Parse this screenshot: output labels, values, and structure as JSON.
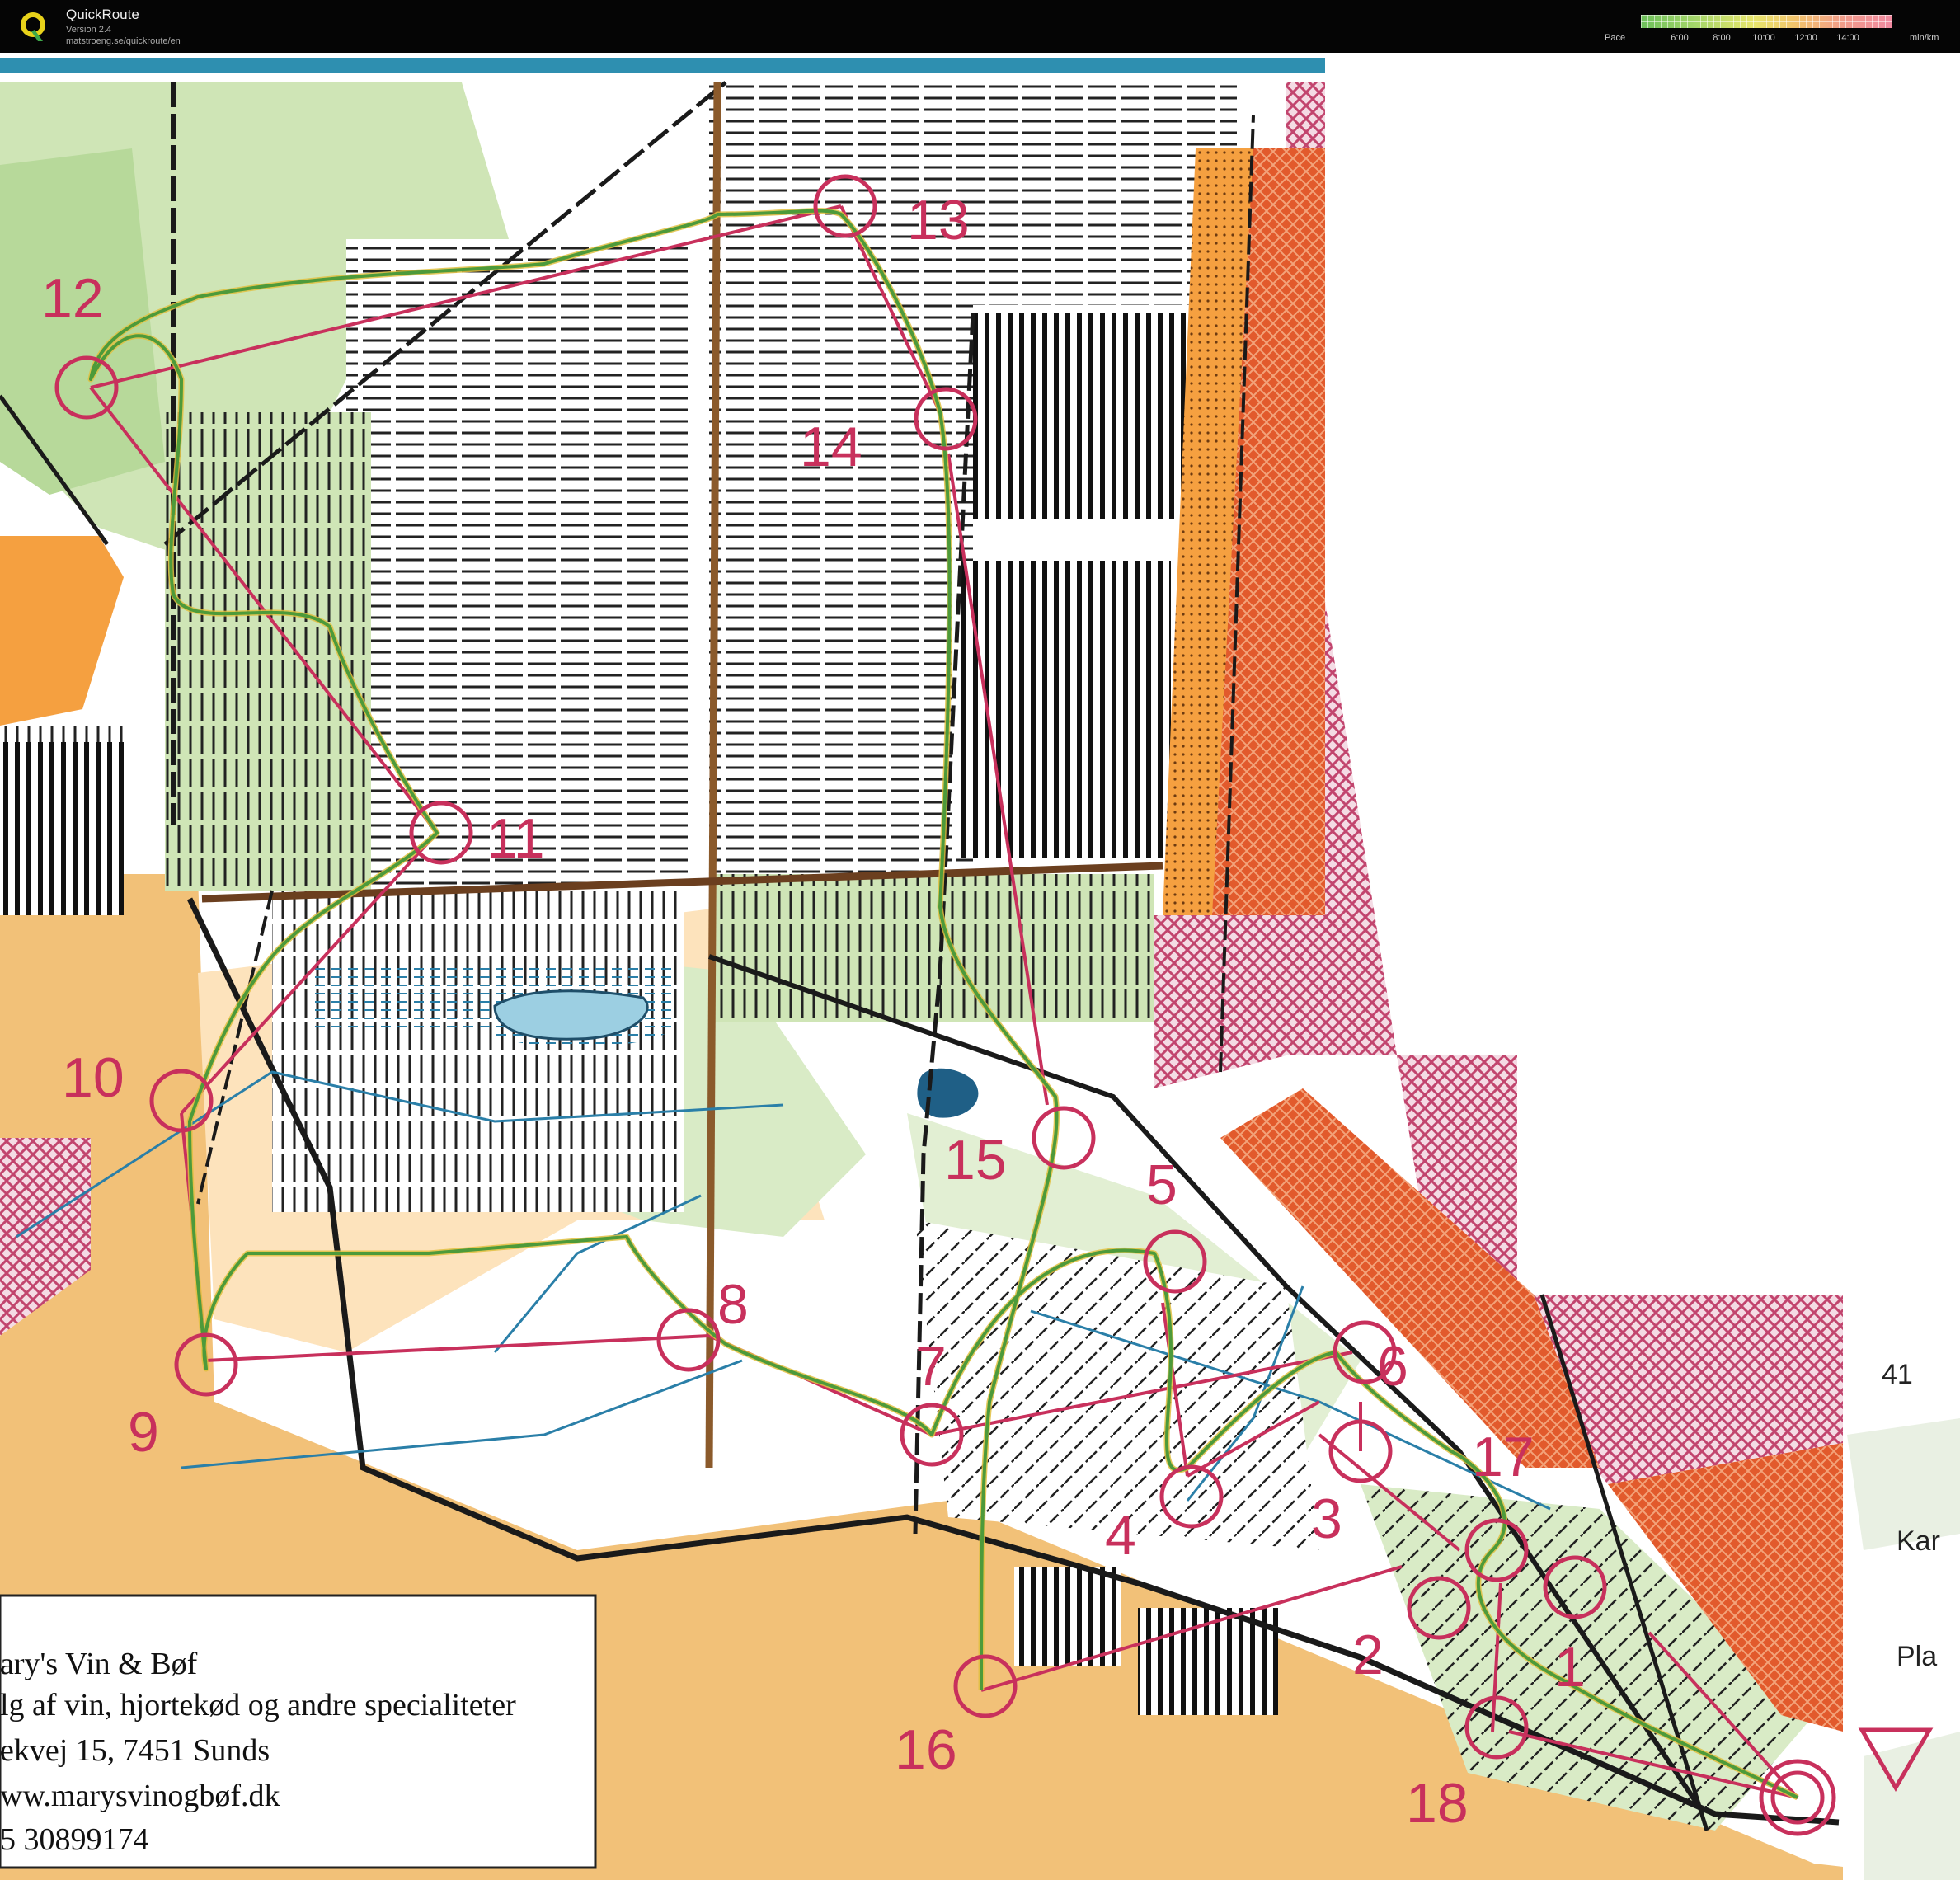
{
  "app": {
    "title": "QuickRoute",
    "version": "Version 2.4",
    "url": "matstroeng.se/quickroute/en"
  },
  "pace_legend": {
    "label": "Pace",
    "ticks": [
      "6:00",
      "8:00",
      "10:00",
      "12:00",
      "14:00"
    ],
    "unit": "min/km"
  },
  "colors": {
    "course": "#c8305c",
    "route": "#5a9a3c",
    "open_land": "#f2c178",
    "forest_green": "#b7d99a",
    "out_of_bounds": "#c2456e",
    "urban": "#e25a2c",
    "water": "#2a7fa8"
  },
  "controls": [
    {
      "id": "1",
      "label": "1"
    },
    {
      "id": "2",
      "label": "2"
    },
    {
      "id": "3",
      "label": "3"
    },
    {
      "id": "4",
      "label": "4"
    },
    {
      "id": "5",
      "label": "5"
    },
    {
      "id": "6",
      "label": "6"
    },
    {
      "id": "7",
      "label": "7"
    },
    {
      "id": "8",
      "label": "8"
    },
    {
      "id": "9",
      "label": "9"
    },
    {
      "id": "10",
      "label": "10"
    },
    {
      "id": "11",
      "label": "11"
    },
    {
      "id": "12",
      "label": "12"
    },
    {
      "id": "13",
      "label": "13"
    },
    {
      "id": "14",
      "label": "14"
    },
    {
      "id": "15",
      "label": "15"
    },
    {
      "id": "16",
      "label": "16"
    },
    {
      "id": "17",
      "label": "17"
    },
    {
      "id": "18",
      "label": "18"
    }
  ],
  "advert": {
    "line1": "ary's Vin & Bøf",
    "line2": "lg af vin, hjortekød og andre specialiteter",
    "line3": "ekvej 15, 7451 Sunds",
    "line4": "ww.marysvinogbøf.dk",
    "line5": "5 30899174"
  },
  "map_labels": {
    "elevation": "41",
    "place1": "Kar",
    "place2": "Pla"
  }
}
